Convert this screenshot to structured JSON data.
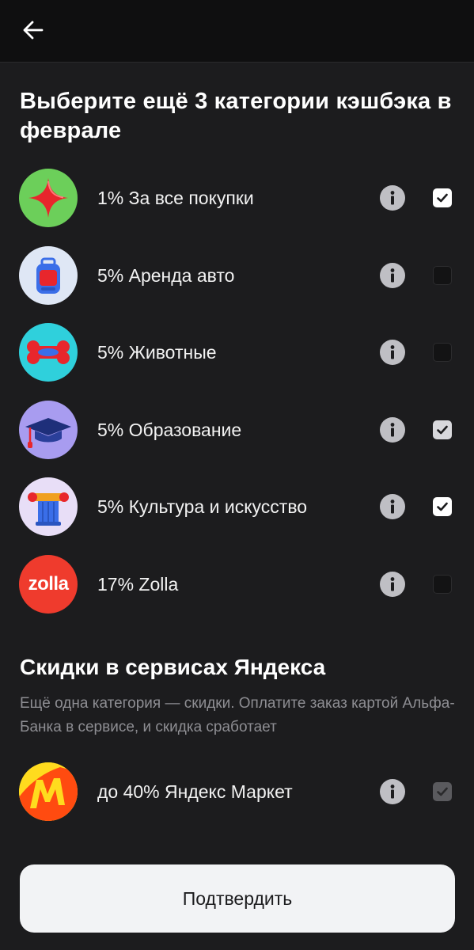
{
  "header": {
    "back_icon": "arrow-left-icon"
  },
  "title": "Выберите ещё 3 категории кэшбэка в феврале",
  "categories": [
    {
      "label": "1% За все покупки",
      "icon": "red-star-icon",
      "icon_bg": "#6ccf5a",
      "checked": true
    },
    {
      "label": "5% Аренда авто",
      "icon": "backpack-icon",
      "icon_bg": "#dfe7f5",
      "checked": false
    },
    {
      "label": "5% Животные",
      "icon": "bone-icon",
      "icon_bg": "#2fd0dc",
      "checked": false
    },
    {
      "label": "5% Образование",
      "icon": "graduation-cap-icon",
      "icon_bg": "#a89cf0",
      "checked": true
    },
    {
      "label": "5% Культура и искусство",
      "icon": "column-icon",
      "icon_bg": "#e8def7",
      "checked": true
    },
    {
      "label": "17% Zolla",
      "icon": "zolla-logo",
      "icon_bg": "#ef3b2d",
      "logo_text": "zolla",
      "checked": false
    }
  ],
  "yandex": {
    "title": "Скидки в сервисах Яндекса",
    "description": "Ещё одна категория — скидки. Оплатите заказ картой Альфа-Банка в сервисе, и скидка сработает",
    "items": [
      {
        "label": "до 40% Яндекс Маркет",
        "icon": "yandex-market-logo",
        "icon_bg": "#ffdb1e",
        "checked": true,
        "disabled": true
      }
    ]
  },
  "confirm_label": "Подтвердить",
  "colors": {
    "background": "#1c1c1e",
    "topbar": "#0f0f10",
    "button_bg": "#f2f3f5",
    "muted_text": "#8e8e93"
  }
}
